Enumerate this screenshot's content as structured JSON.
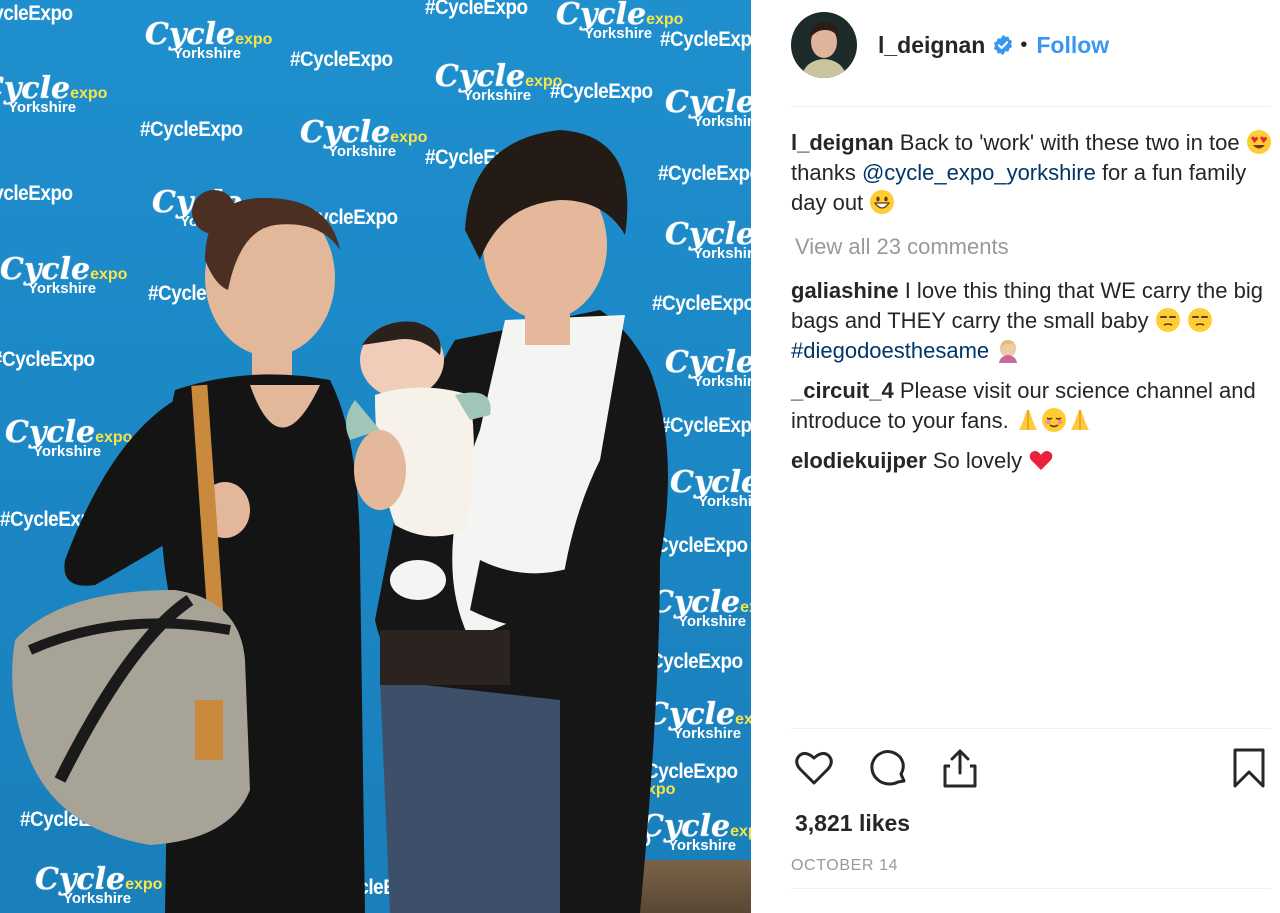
{
  "post": {
    "username": "l_deignan",
    "follow_label": "Follow",
    "separator": "•",
    "caption": {
      "username": "l_deignan",
      "text_1": " Back to 'work' with these two in toe ",
      "text_2": " thanks ",
      "mention": "@cycle_expo_yorkshire",
      "text_3": " for a fun family day out "
    },
    "view_all_comments": "View all 23 comments",
    "comments": [
      {
        "username": "galiashine",
        "text_1": " I love this thing that WE carry the big bags and THEY carry the small baby ",
        "text_2": " ",
        "hashtag": "#diegodoesthesame",
        "text_3": " "
      },
      {
        "username": "_circuit_4",
        "text_1": " Please visit our science channel and introduce to your fans. "
      },
      {
        "username": "elodiekuijper",
        "text_1": " So lovely "
      }
    ],
    "likes": "3,821 likes",
    "date": "OCTOBER 14"
  },
  "backdrop": {
    "brand_line_1": "Cycle",
    "brand_line_2": "expo",
    "brand_line_3": "Yorkshire",
    "hashtag": "#CycleExpo"
  },
  "icons": {
    "verified": "verified-badge-icon",
    "like": "heart-icon",
    "comment": "speech-bubble-icon",
    "share": "share-icon",
    "save": "bookmark-icon"
  },
  "colors": {
    "link": "#3897f0",
    "mention": "#003569",
    "muted": "#999999",
    "backdrop_blue": "#1f8fce",
    "brand_yellow": "#f7e44a"
  }
}
